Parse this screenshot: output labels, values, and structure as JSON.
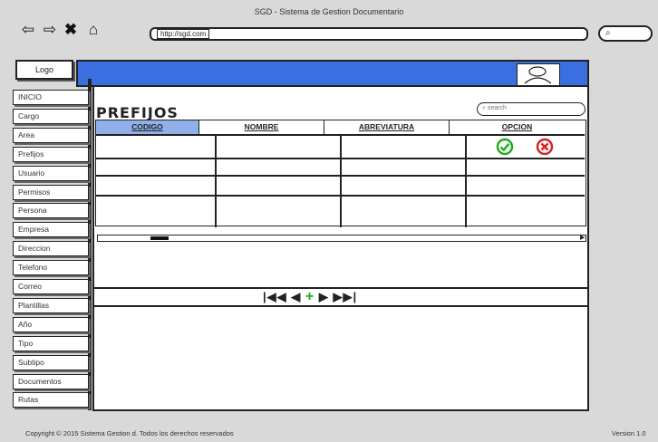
{
  "window": {
    "title": "SGD - Sistema de Gestion Documentario"
  },
  "browser": {
    "url": "http://sgd.com",
    "search_icon": "search-icon"
  },
  "logo": {
    "label": "Logo"
  },
  "sidebar": {
    "items": [
      {
        "label": "INICIO"
      },
      {
        "label": "Cargo"
      },
      {
        "label": "Area"
      },
      {
        "label": "Prefijos"
      },
      {
        "label": "Usuario"
      },
      {
        "label": "Permisos"
      },
      {
        "label": "Persona"
      },
      {
        "label": "Empresa"
      },
      {
        "label": "Direccion"
      },
      {
        "label": "Telefono"
      },
      {
        "label": "Correo"
      },
      {
        "label": "Plantillas"
      },
      {
        "label": "Año"
      },
      {
        "label": "Tipo"
      },
      {
        "label": "Subtipo"
      },
      {
        "label": "Documentos"
      },
      {
        "label": "Rutas"
      }
    ]
  },
  "main": {
    "title": "PREFIJOS",
    "search_placeholder": "search",
    "table": {
      "columns": [
        "CODIGO",
        "NOMBRE",
        "ABREVIATURA",
        "OPCION"
      ],
      "rows": 4
    },
    "pager": {
      "first": "|◀◀",
      "prev": "◀",
      "add": "+",
      "next": "▶",
      "last": "▶▶|"
    }
  },
  "colors": {
    "header_blue": "#3b6fe0",
    "active_column": "#8fb0e8",
    "accept_green": "#22aa22",
    "delete_red": "#dd2222"
  },
  "footer": {
    "copyright": "Copyright © 2015 Sistema Gestion d. Todos los derechos reservados",
    "version": "Version 1.0"
  }
}
